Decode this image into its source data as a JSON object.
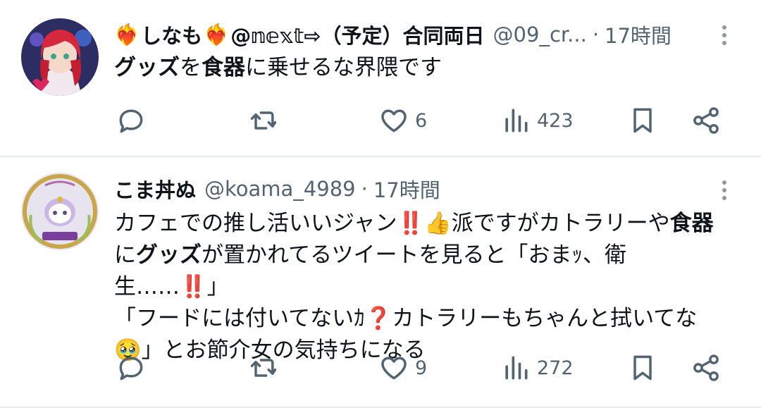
{
  "tweets": [
    {
      "name_prefix_emoji": "❤️‍🔥",
      "name_text": "しなも",
      "name_mid_emoji": "❤️‍🔥",
      "name_suffix": "@𝕟𝕖𝕩𝕥⇨（予定）合同両日",
      "handle": "@09_cr...",
      "dot": "·",
      "time": "17時間",
      "body": [
        {
          "t": "グッズ",
          "b": true
        },
        {
          "t": "を",
          "b": false
        },
        {
          "t": "食器",
          "b": true
        },
        {
          "t": "に乗せるな界隈です",
          "b": false
        }
      ],
      "likes": "6",
      "views": "423"
    },
    {
      "name": "こま丼ぬ",
      "handle": "@koama_4989",
      "dot": "·",
      "time": "17時間",
      "body_lines": {
        "l1a": "カフェでの推し活いいジャン",
        "l1_bang": "‼️",
        "l1_thumb": "👍",
        "l1b": "派ですがカトラリーや",
        "l1c": "食器",
        "l2a": "に",
        "l2b": "グッズ",
        "l2c": "が置かれてるツイートを見ると「おまｯ、衛生……",
        "l2_bang": "‼️",
        "l2d": "」",
        "l3a": "「フードには付いてないｶ",
        "l3_q": "❓",
        "l3b": "カトラリーもちゃんと拭いてな",
        "l4_emoji": "🥹",
        "l4a": "」とお節介女の気持ちになる"
      },
      "likes": "9",
      "views": "272"
    }
  ],
  "icons": {
    "reply": "reply-icon",
    "retweet": "retweet-icon",
    "like": "heart-icon",
    "views": "views-icon",
    "bookmark": "bookmark-icon",
    "share": "share-icon",
    "more": "more-icon"
  },
  "colors": {
    "text": "#0f1419",
    "secondary": "#536471",
    "divider": "#e6ecf0"
  }
}
